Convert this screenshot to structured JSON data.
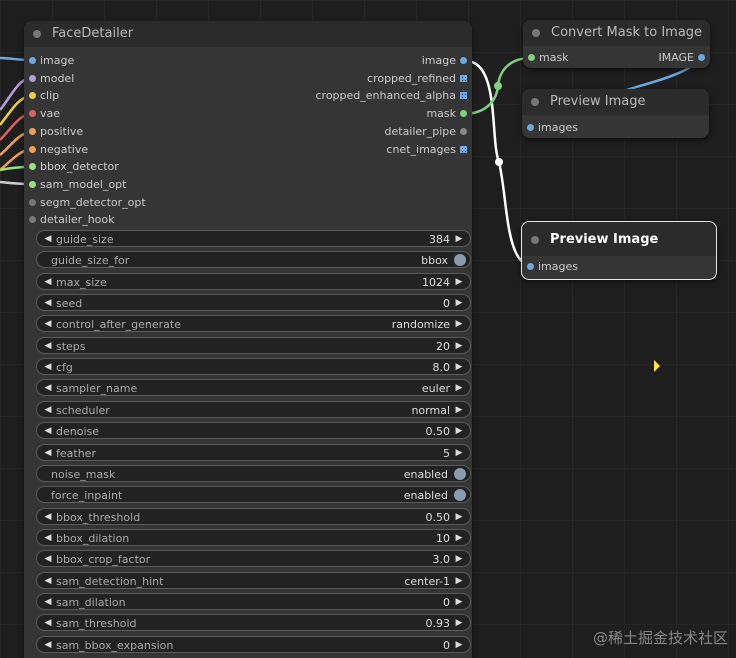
{
  "face_detailer": {
    "title": "FaceDetailer",
    "inputs": [
      {
        "label": "image",
        "color": "#6ea8e0"
      },
      {
        "label": "model",
        "color": "#b39ddb"
      },
      {
        "label": "clip",
        "color": "#f0d040"
      },
      {
        "label": "vae",
        "color": "#e06060"
      },
      {
        "label": "positive",
        "color": "#f0a050"
      },
      {
        "label": "negative",
        "color": "#f0a050"
      },
      {
        "label": "bbox_detector",
        "color": "#9be07a"
      },
      {
        "label": "sam_model_opt",
        "color": "#9be07a"
      },
      {
        "label": "segm_detector_opt",
        "color": "#777777"
      },
      {
        "label": "detailer_hook",
        "color": "#777777"
      }
    ],
    "outputs": [
      {
        "label": "image",
        "kind": "dot",
        "color": "#6ea8e0"
      },
      {
        "label": "cropped_refined",
        "kind": "grid"
      },
      {
        "label": "cropped_enhanced_alpha",
        "kind": "grid"
      },
      {
        "label": "mask",
        "kind": "dot",
        "color": "#7ed07a"
      },
      {
        "label": "detailer_pipe",
        "kind": "dot",
        "color": "#888888"
      },
      {
        "label": "cnet_images",
        "kind": "grid"
      }
    ],
    "widgets": [
      {
        "label": "guide_size",
        "value": "384",
        "type": "number"
      },
      {
        "label": "guide_size_for",
        "value": "bbox",
        "type": "toggle"
      },
      {
        "label": "max_size",
        "value": "1024",
        "type": "number"
      },
      {
        "label": "seed",
        "value": "0",
        "type": "number"
      },
      {
        "label": "control_after_generate",
        "value": "randomize",
        "type": "number"
      },
      {
        "label": "steps",
        "value": "20",
        "type": "number"
      },
      {
        "label": "cfg",
        "value": "8.0",
        "type": "number"
      },
      {
        "label": "sampler_name",
        "value": "euler",
        "type": "number"
      },
      {
        "label": "scheduler",
        "value": "normal",
        "type": "number"
      },
      {
        "label": "denoise",
        "value": "0.50",
        "type": "number"
      },
      {
        "label": "feather",
        "value": "5",
        "type": "number"
      },
      {
        "label": "noise_mask",
        "value": "enabled",
        "type": "toggle"
      },
      {
        "label": "force_inpaint",
        "value": "enabled",
        "type": "toggle"
      },
      {
        "label": "bbox_threshold",
        "value": "0.50",
        "type": "number"
      },
      {
        "label": "bbox_dilation",
        "value": "10",
        "type": "number"
      },
      {
        "label": "bbox_crop_factor",
        "value": "3.0",
        "type": "number"
      },
      {
        "label": "sam_detection_hint",
        "value": "center-1",
        "type": "number"
      },
      {
        "label": "sam_dilation",
        "value": "0",
        "type": "number"
      },
      {
        "label": "sam_threshold",
        "value": "0.93",
        "type": "number"
      },
      {
        "label": "sam_bbox_expansion",
        "value": "0",
        "type": "number"
      }
    ]
  },
  "convert_node": {
    "title": "Convert Mask to Image",
    "input": "mask",
    "output": "IMAGE"
  },
  "preview_node_1": {
    "title": "Preview Image",
    "input": "images"
  },
  "preview_node_2": {
    "title": "Preview Image",
    "input": "images"
  },
  "watermark": "@稀土掘金技术社区",
  "icons": {
    "left": "◀",
    "right": "▶"
  }
}
